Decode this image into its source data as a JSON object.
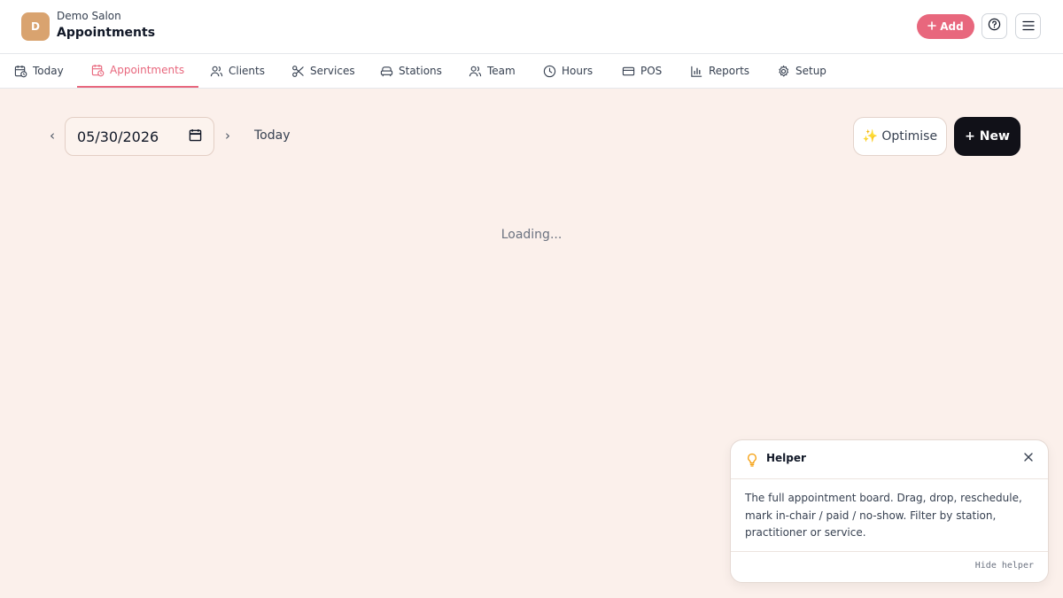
{
  "header": {
    "avatar_letter": "D",
    "salon_name": "Demo Salon",
    "page_title": "Appointments",
    "add_label": "Add",
    "brand_color": "#e8677d"
  },
  "nav": {
    "items": [
      {
        "label": "Today",
        "icon": "calendar-clock-icon",
        "active": false
      },
      {
        "label": "Appointments",
        "icon": "calendar-clock-icon",
        "active": true
      },
      {
        "label": "Clients",
        "icon": "users-icon",
        "active": false
      },
      {
        "label": "Services",
        "icon": "scissors-icon",
        "active": false
      },
      {
        "label": "Stations",
        "icon": "armchair-icon",
        "active": false
      },
      {
        "label": "Team",
        "icon": "users-icon",
        "active": false
      },
      {
        "label": "Hours",
        "icon": "clock-icon",
        "active": false
      },
      {
        "label": "POS",
        "icon": "credit-card-icon",
        "active": false
      },
      {
        "label": "Reports",
        "icon": "bar-chart-icon",
        "active": false
      },
      {
        "label": "Setup",
        "icon": "gear-icon",
        "active": false
      }
    ]
  },
  "toolbar": {
    "prev": "‹",
    "next": "›",
    "date_value": "05/30/2026",
    "today_label": "Today",
    "optimise_label": "Optimise",
    "optimise_emoji": "✨",
    "new_label": "+ New"
  },
  "main": {
    "loading_text": "Loading..."
  },
  "helper": {
    "title": "Helper",
    "body": "The full appointment board. Drag, drop, reschedule, mark in-chair / paid / no-show. Filter by station, practitioner or service.",
    "hide_label": "Hide helper"
  }
}
